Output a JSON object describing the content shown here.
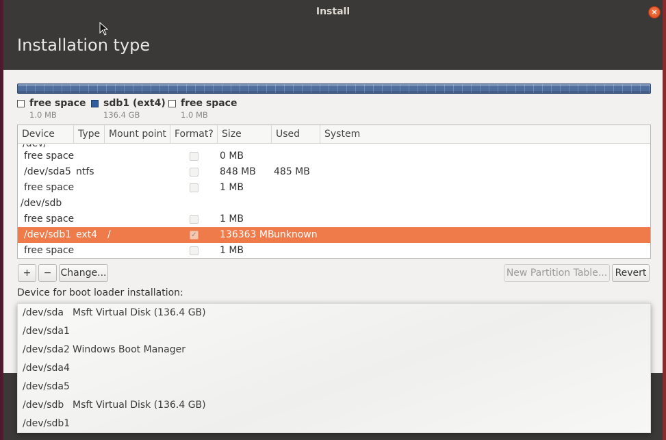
{
  "window": {
    "title": "Install",
    "close_glyph": "×"
  },
  "page": {
    "title": "Installation type"
  },
  "partition_bar": {
    "color": "#4f6e9e",
    "legend": [
      {
        "name": "free space",
        "size": "1.0 MB",
        "filled": false
      },
      {
        "name": "sdb1 (ext4)",
        "size": "136.4 GB",
        "filled": true
      },
      {
        "name": "free space",
        "size": "1.0 MB",
        "filled": false
      }
    ]
  },
  "table": {
    "columns": [
      "Device",
      "Type",
      "Mount point",
      "Format?",
      "Size",
      "Used",
      "System"
    ],
    "clipped_top_text": "/dev/",
    "rows": [
      {
        "device": "free space",
        "type": "",
        "mount": "",
        "format": false,
        "size": "0 MB",
        "used": "",
        "system": "",
        "indent": true,
        "checkbox": true
      },
      {
        "device": "/dev/sda5",
        "type": "ntfs",
        "mount": "",
        "format": false,
        "size": "848 MB",
        "used": "485 MB",
        "system": "",
        "indent": true,
        "checkbox": true
      },
      {
        "device": "free space",
        "type": "",
        "mount": "",
        "format": false,
        "size": "1 MB",
        "used": "",
        "system": "",
        "indent": true,
        "checkbox": true
      },
      {
        "device": "/dev/sdb",
        "type": "",
        "mount": "",
        "format": false,
        "size": "",
        "used": "",
        "system": "",
        "indent": false,
        "checkbox": false
      },
      {
        "device": "free space",
        "type": "",
        "mount": "",
        "format": false,
        "size": "1 MB",
        "used": "",
        "system": "",
        "indent": true,
        "checkbox": true
      },
      {
        "device": "/dev/sdb1",
        "type": "ext4",
        "mount": "/",
        "format": true,
        "size": "136363 MB",
        "used": "unknown",
        "system": "",
        "indent": true,
        "checkbox": true,
        "selected": true
      },
      {
        "device": "free space",
        "type": "",
        "mount": "",
        "format": false,
        "size": "1 MB",
        "used": "",
        "system": "",
        "indent": true,
        "checkbox": true
      }
    ],
    "selected_color": "#ef7b4b"
  },
  "buttons": {
    "add": "+",
    "remove": "−",
    "change": "Change...",
    "new_partition_table": "New Partition Table...",
    "revert": "Revert"
  },
  "bootloader": {
    "label": "Device for boot loader installation:",
    "options": [
      {
        "device": "/dev/sda",
        "description": "Msft Virtual Disk (136.4 GB)"
      },
      {
        "device": "/dev/sda1",
        "description": ""
      },
      {
        "device": "/dev/sda2",
        "description": "Windows Boot Manager"
      },
      {
        "device": "/dev/sda4",
        "description": ""
      },
      {
        "device": "/dev/sda5",
        "description": ""
      },
      {
        "device": "/dev/sdb",
        "description": "Msft Virtual Disk (136.4 GB)"
      },
      {
        "device": "/dev/sdb1",
        "description": ""
      }
    ]
  }
}
